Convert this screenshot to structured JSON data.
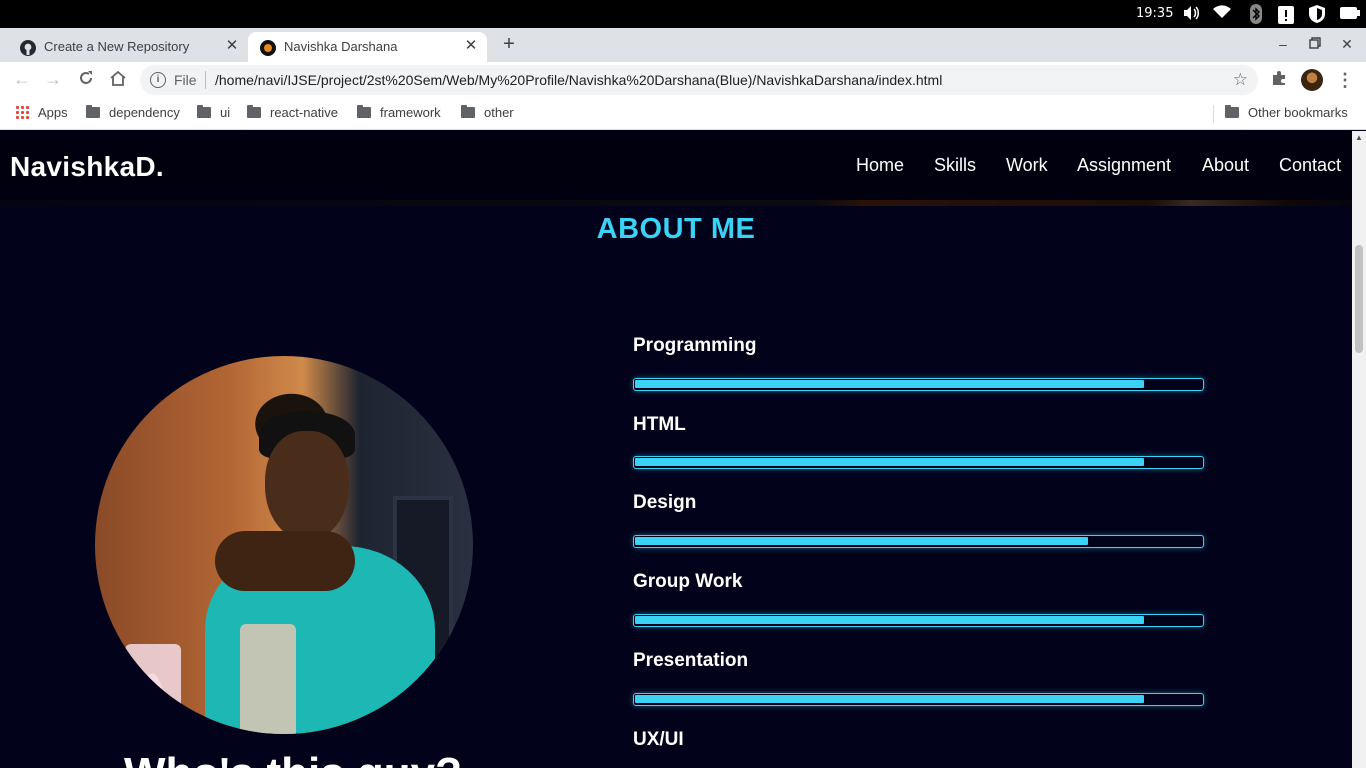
{
  "os": {
    "time": "19:35",
    "icons": [
      "volume-icon",
      "wifi-icon",
      "bluetooth-icon",
      "clipboard-icon",
      "shield-icon",
      "battery-icon"
    ]
  },
  "browser": {
    "tabs": [
      {
        "title": "Create a New Repository",
        "icon": "github-icon",
        "active": false
      },
      {
        "title": "Navishka Darshana",
        "icon": "site-favicon",
        "active": true
      }
    ],
    "new_tab_glyph": "+",
    "address": {
      "scheme": "File",
      "url": "/home/navi/IJSE/project/2st%20Sem/Web/My%20Profile/Navishka%20Darshana(Blue)/NavishkaDarshana/index.html"
    },
    "bookmarks": [
      {
        "label": "Apps",
        "icon": "apps-grid-icon"
      },
      {
        "label": "dependency",
        "icon": "folder-icon"
      },
      {
        "label": "ui",
        "icon": "folder-icon"
      },
      {
        "label": "react-native",
        "icon": "folder-icon"
      },
      {
        "label": "framework",
        "icon": "folder-icon"
      },
      {
        "label": "other",
        "icon": "folder-icon"
      }
    ],
    "other_bookmarks": "Other bookmarks"
  },
  "site": {
    "brand": "NavishkaD.",
    "nav": [
      "Home",
      "Skills",
      "Work",
      "Assignment",
      "About",
      "Contact"
    ],
    "section_title": "ABOUT ME",
    "who_heading": "Who's this guy?",
    "accent_color": "#3ad3f5",
    "skills": [
      {
        "label": "Programming",
        "level": 0.9
      },
      {
        "label": "HTML",
        "level": 0.9
      },
      {
        "label": "Design",
        "level": 0.8
      },
      {
        "label": "Group Work",
        "level": 0.9
      },
      {
        "label": "Presentation",
        "level": 0.9
      },
      {
        "label": "UX/UI"
      }
    ]
  }
}
